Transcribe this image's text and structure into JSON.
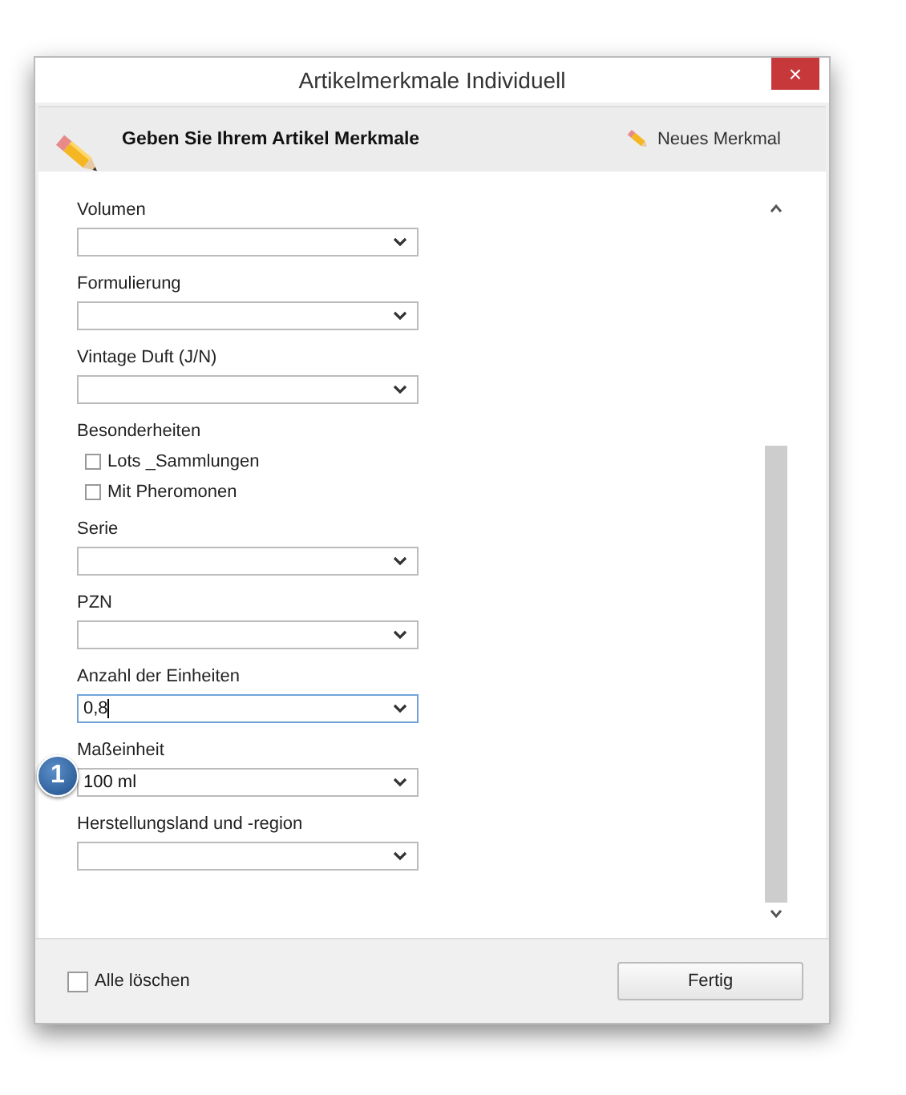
{
  "window": {
    "title": "Artikelmerkmale Individuell",
    "close": "×"
  },
  "header": {
    "text": "Geben Sie Ihrem Artikel Merkmale",
    "new_button": "Neues Merkmal"
  },
  "fields": [
    {
      "kind": "select",
      "label": "Volumen",
      "focused": false
    },
    {
      "kind": "select",
      "label": "Formulierung",
      "focused": false
    },
    {
      "kind": "select",
      "label": "Vintage Duft (J/N)",
      "focused": false
    },
    {
      "kind": "checks",
      "label": "Besonderheiten",
      "options": [
        {
          "label": "Lots _Sammlungen",
          "checked": false
        },
        {
          "label": "Mit Pheromonen",
          "checked": false
        }
      ]
    },
    {
      "kind": "select",
      "label": "Serie",
      "focused": false
    },
    {
      "kind": "select",
      "label": "PZN",
      "focused": false
    },
    {
      "kind": "select",
      "label": "Anzahl der Einheiten",
      "value": "0,8",
      "focused": true
    },
    {
      "kind": "select",
      "label": "Maßeinheit",
      "value": "100 ml",
      "focused": false
    },
    {
      "kind": "select",
      "label": "Herstellungsland und -region",
      "focused": false
    }
  ],
  "badge": "1",
  "footer": {
    "clear_all": {
      "label": "Alle löschen",
      "checked": false
    },
    "done_button": "Fertig"
  }
}
